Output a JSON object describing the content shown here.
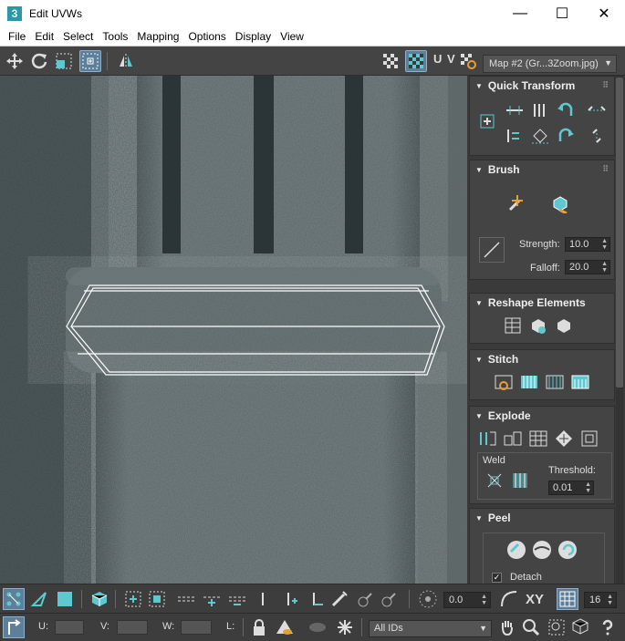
{
  "window": {
    "title": "Edit UVWs",
    "app_icon": "3",
    "minimize": "—",
    "maximize": "☐",
    "close": "✕"
  },
  "menu": [
    "File",
    "Edit",
    "Select",
    "Tools",
    "Mapping",
    "Options",
    "Display",
    "View"
  ],
  "toolbar": {
    "uv_label": "U V",
    "map_select": "Map #2 (Gr...3Zoom.jpg)"
  },
  "panels": {
    "quick_transform": {
      "title": "Quick Transform"
    },
    "brush": {
      "title": "Brush",
      "strength_label": "Strength:",
      "strength_value": "10.0",
      "falloff_label": "Falloff:",
      "falloff_value": "20.0"
    },
    "reshape": {
      "title": "Reshape Elements"
    },
    "stitch": {
      "title": "Stitch"
    },
    "explode": {
      "title": "Explode",
      "weld_label": "Weld",
      "threshold_label": "Threshold:",
      "threshold_value": "0.01"
    },
    "peel": {
      "title": "Peel",
      "detach_label": "Detach",
      "detach_checked": true
    }
  },
  "bottom": {
    "angle_value": "0.0",
    "xy_label": "XY",
    "grid_value": "16",
    "u_label": "U:",
    "v_label": "V:",
    "w_label": "W:",
    "l_label": "L:",
    "ids_select": "All IDs"
  },
  "colors": {
    "accent": "#5ec8d0",
    "panel_bg": "#444444",
    "active_btn": "#5e7f9a"
  }
}
